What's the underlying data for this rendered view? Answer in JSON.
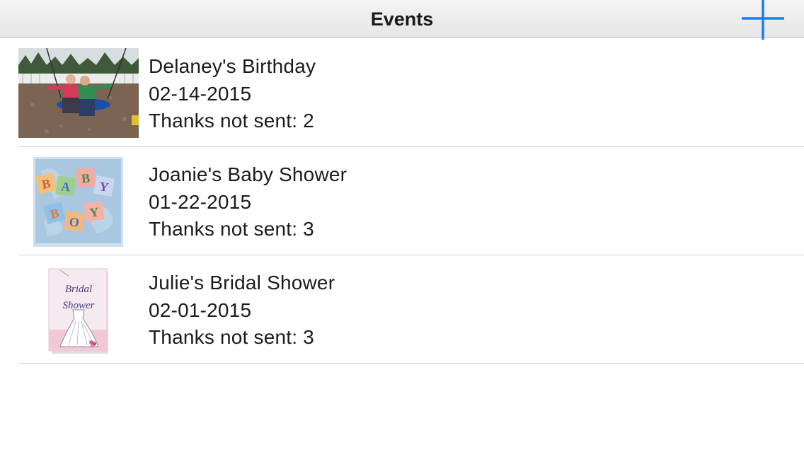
{
  "navbar": {
    "title": "Events",
    "add_icon": "plus-icon",
    "accent_color": "#1a7cf0"
  },
  "events": [
    {
      "name": "Delaney's Birthday",
      "date": "02-14-2015",
      "thanks": "Thanks not sent: 2",
      "thumbnail": "photo-children-on-swing"
    },
    {
      "name": "Joanie's Baby Shower",
      "date": "01-22-2015",
      "thanks": "Thanks not sent: 3",
      "thumbnail": "baby-boy-blocks-card",
      "blocks": [
        "B",
        "A",
        "B",
        "Y",
        "B",
        "O",
        "Y"
      ]
    },
    {
      "name": "Julie's Bridal Shower",
      "date": "02-01-2015",
      "thanks": "Thanks not sent: 3",
      "thumbnail": "bridal-shower-dress-card",
      "card_text": [
        "Bridal",
        "Shower"
      ]
    }
  ]
}
